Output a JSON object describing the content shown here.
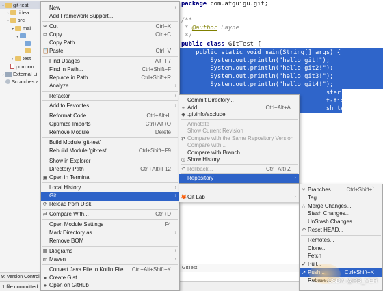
{
  "project_tree": [
    {
      "label": "git-test",
      "icon": "folder",
      "arrow": "▾",
      "indent": 0,
      "selected": true
    },
    {
      "label": ".idea",
      "icon": "folder",
      "arrow": "›",
      "indent": 1
    },
    {
      "label": "src",
      "icon": "folder",
      "arrow": "▾",
      "indent": 1
    },
    {
      "label": "mai",
      "icon": "folder",
      "arrow": "▾",
      "indent": 2
    },
    {
      "label": "",
      "icon": "folder-blue",
      "arrow": "▾",
      "indent": 3
    },
    {
      "label": "",
      "icon": "folder-blue",
      "arrow": "",
      "indent": 4
    },
    {
      "label": "",
      "icon": "folder",
      "arrow": "",
      "indent": 4
    },
    {
      "label": "test",
      "icon": "folder",
      "arrow": "›",
      "indent": 2
    },
    {
      "label": "pom.xm",
      "icon": "file",
      "arrow": "",
      "indent": 1
    },
    {
      "label": "External Li",
      "icon": "lib",
      "arrow": "›",
      "indent": 0
    },
    {
      "label": "Scratches a",
      "icon": "scratch",
      "arrow": "",
      "indent": 0
    }
  ],
  "editor": {
    "lines": [
      {
        "text": "package com.atguigu.git;",
        "type": "package"
      },
      {
        "text": "",
        "type": "blank"
      },
      {
        "text": "/**",
        "type": "comment"
      },
      {
        "text": " * @author Layne",
        "type": "author"
      },
      {
        "text": " */",
        "type": "comment"
      },
      {
        "text": "public class GItTest {",
        "type": "class"
      },
      {
        "text": "    public static void main(String[] args) {",
        "type": "sel"
      },
      {
        "text": "        System.out.println(\"hello git!\");",
        "type": "sel"
      },
      {
        "text": "        System.out.println(\"hello git2!\");",
        "type": "sel"
      },
      {
        "text": "        System.out.println(\"hello git3!\");",
        "type": "sel"
      },
      {
        "text": "        System.out.println(\"hello git4!\");",
        "type": "sel"
      },
      {
        "text": "                                        ster test!\");",
        "type": "sel"
      },
      {
        "text": "                                        t-fix test!\");",
        "type": "sel"
      },
      {
        "text": "                                        sh test!\");",
        "type": "sel"
      }
    ],
    "breadcrumb": "GItTest"
  },
  "context_menu": {
    "items": [
      {
        "label": "New",
        "sub": true
      },
      {
        "label": "Add Framework Support..."
      },
      {
        "sep": true
      },
      {
        "label": "Cut",
        "shortcut": "Ctrl+X",
        "icon": "cut-icon",
        "glyph": "✂"
      },
      {
        "label": "Copy",
        "shortcut": "Ctrl+C",
        "icon": "copy-icon",
        "glyph": "⧉"
      },
      {
        "label": "Copy Path..."
      },
      {
        "label": "Paste",
        "shortcut": "Ctrl+V",
        "icon": "paste-icon",
        "glyph": "📋"
      },
      {
        "sep": true
      },
      {
        "label": "Find Usages",
        "shortcut": "Alt+F7"
      },
      {
        "label": "Find in Path...",
        "shortcut": "Ctrl+Shift+F"
      },
      {
        "label": "Replace in Path...",
        "shortcut": "Ctrl+Shift+R"
      },
      {
        "label": "Analyze",
        "sub": true
      },
      {
        "sep": true
      },
      {
        "label": "Refactor",
        "sub": true
      },
      {
        "sep": true
      },
      {
        "label": "Add to Favorites",
        "sub": true
      },
      {
        "sep": true
      },
      {
        "label": "Reformat Code",
        "shortcut": "Ctrl+Alt+L"
      },
      {
        "label": "Optimize Imports",
        "shortcut": "Ctrl+Alt+O"
      },
      {
        "label": "Remove Module",
        "shortcut": "Delete"
      },
      {
        "sep": true
      },
      {
        "label": "Build Module 'git-test'"
      },
      {
        "label": "Rebuild Module 'git-test'",
        "shortcut": "Ctrl+Shift+F9"
      },
      {
        "sep": true
      },
      {
        "label": "Show in Explorer"
      },
      {
        "label": "Directory Path",
        "shortcut": "Ctrl+Alt+F12"
      },
      {
        "label": "Open in Terminal",
        "icon": "terminal-icon",
        "glyph": "▣"
      },
      {
        "sep": true
      },
      {
        "label": "Local History",
        "sub": true
      },
      {
        "label": "Git",
        "sub": true,
        "highlighted": true
      },
      {
        "label": "Reload from Disk",
        "icon": "reload-icon",
        "glyph": "⟳"
      },
      {
        "sep": true
      },
      {
        "label": "Compare With...",
        "shortcut": "Ctrl+D",
        "icon": "compare-icon",
        "glyph": "⇄"
      },
      {
        "sep": true
      },
      {
        "label": "Open Module Settings",
        "shortcut": "F4"
      },
      {
        "label": "Mark Directory as",
        "sub": true
      },
      {
        "label": "Remove BOM"
      },
      {
        "sep": true
      },
      {
        "label": "Diagrams",
        "sub": true,
        "icon": "diagram-icon",
        "glyph": "▦"
      },
      {
        "label": "Maven",
        "sub": true,
        "icon": "maven-icon",
        "glyph": "m"
      },
      {
        "sep": true
      },
      {
        "label": "Convert Java File to Kotlin File",
        "shortcut": "Ctrl+Alt+Shift+K"
      },
      {
        "label": "Create Gist...",
        "icon": "github-icon",
        "glyph": "●"
      },
      {
        "label": "Open on GitHub",
        "icon": "github-icon",
        "glyph": "●"
      }
    ]
  },
  "vcs_menu": {
    "items": [
      {
        "label": "Commit Directory..."
      },
      {
        "label": "Add",
        "shortcut": "Ctrl+Alt+A",
        "icon": "add-icon",
        "glyph": "+"
      },
      {
        "label": ".git/info/exclude",
        "icon": "git-icon",
        "glyph": "◆"
      },
      {
        "sep": true
      },
      {
        "label": "Annotate",
        "disabled": true
      },
      {
        "label": "Show Current Revision",
        "disabled": true
      },
      {
        "label": "Compare with the Same Repository Version",
        "disabled": true,
        "icon": "compare-icon",
        "glyph": "⇄"
      },
      {
        "label": "Compare with...",
        "disabled": true
      },
      {
        "label": "Compare with Branch..."
      },
      {
        "label": "Show History",
        "icon": "history-icon",
        "glyph": "◷"
      },
      {
        "sep": true
      },
      {
        "label": "Rollback...",
        "shortcut": "Ctrl+Alt+Z",
        "disabled": true,
        "icon": "rollback-icon",
        "glyph": "↶"
      },
      {
        "sep": true
      },
      {
        "label": "Repository",
        "sub": true,
        "highlighted": true
      }
    ]
  },
  "git_menu": {
    "items": [
      {
        "label": "Git Lab",
        "sub": true,
        "icon": "gitlab-icon",
        "glyph": "🦊"
      }
    ]
  },
  "repo_menu": {
    "items": [
      {
        "label": "Branches...",
        "shortcut": "Ctrl+Shift+`",
        "icon": "branch-icon",
        "glyph": "⑂"
      },
      {
        "label": "Tag..."
      },
      {
        "label": "Merge Changes...",
        "icon": "merge-icon",
        "glyph": "⑃"
      },
      {
        "label": "Stash Changes..."
      },
      {
        "label": "UnStash Changes..."
      },
      {
        "label": "Reset HEAD...",
        "icon": "reset-icon",
        "glyph": "↶"
      },
      {
        "sep": true
      },
      {
        "label": "Remotes..."
      },
      {
        "label": "Clone..."
      },
      {
        "label": "Fetch"
      },
      {
        "label": "Pull...",
        "icon": "pull-icon",
        "glyph": "✔"
      },
      {
        "label": "Push...",
        "shortcut": "Ctrl+Shift+K",
        "highlighted": true,
        "icon": "push-icon",
        "glyph": "↗"
      },
      {
        "label": "Rebase..."
      }
    ]
  },
  "bottom_strip": {
    "label": "9: Version Control"
  },
  "status": {
    "text": "1 file committed"
  },
  "watermark": "CSDN @RB_VER",
  "colors": {
    "selection": "#2f65ca",
    "menu_highlight": "#2e63c8",
    "menu_bg": "#f2f2f2"
  }
}
